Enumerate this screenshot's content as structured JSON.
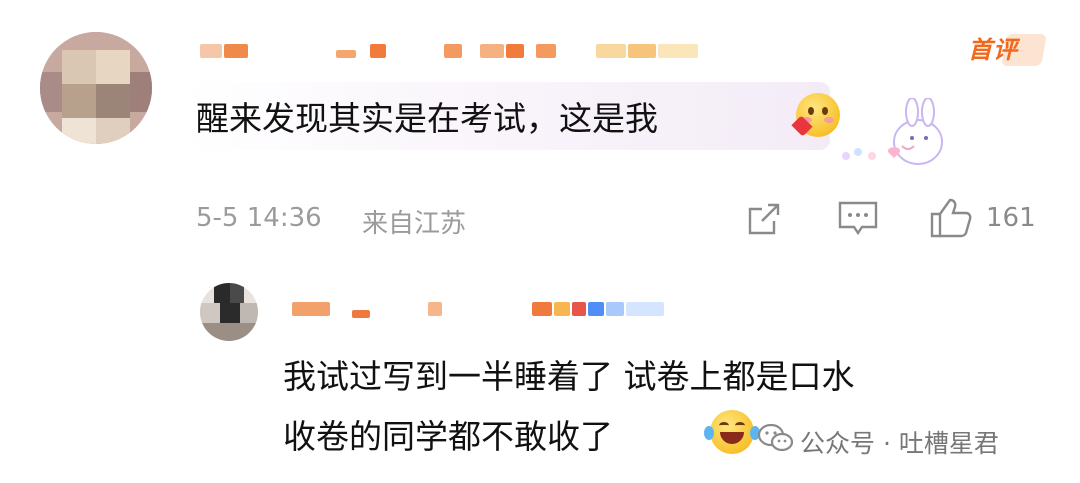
{
  "first_comment": {
    "badge": "首评",
    "text": "醒来发现其实是在考试，这是我",
    "timestamp": "5-5 14:36",
    "location": "来自江苏",
    "like_count": "161"
  },
  "reply": {
    "line1": "我试过写到一半睡着了 试卷上都是口水",
    "line2": "收卷的同学都不敢收了"
  },
  "watermark": {
    "label": "公众号 · 吐槽星君"
  },
  "icons": [
    "share-icon",
    "reply-comment-icon",
    "thumbs-up-icon",
    "blush-heart-emoji",
    "laughing-tears-emoji",
    "wechat-icon",
    "bunny-sticker"
  ]
}
